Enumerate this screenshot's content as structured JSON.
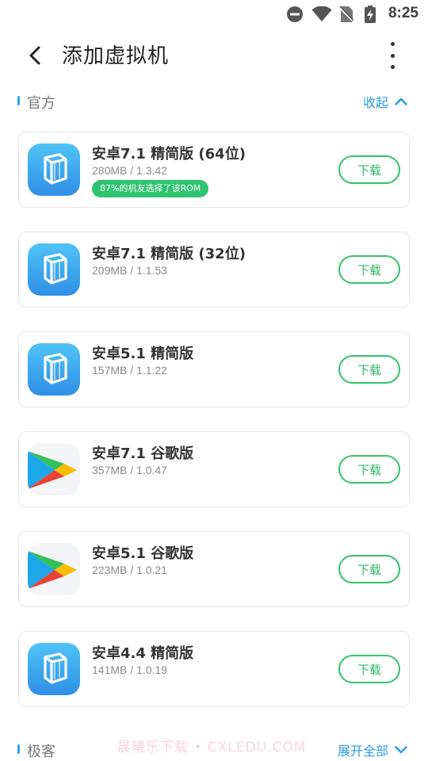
{
  "status_bar": {
    "time": "8:25",
    "icons": [
      "dnd-icon",
      "wifi-icon",
      "no-sim-icon",
      "battery-charging-icon"
    ]
  },
  "header": {
    "title": "添加虚拟机",
    "back_icon": "back-arrow-icon",
    "more_icon": "more-vertical-icon"
  },
  "sections": [
    {
      "title": "官方",
      "toggle_label": "收起",
      "toggle_icon": "chevron-up-icon"
    },
    {
      "title": "极客",
      "toggle_label": "展开全部",
      "toggle_icon": "chevron-down-icon"
    }
  ],
  "roms": [
    {
      "name": "安卓7.1 精简版 (64位)",
      "meta": "280MB / 1.3.42",
      "badge": "87%的机友选择了该ROM",
      "icon": "vm-cube-icon",
      "button": "下载"
    },
    {
      "name": "安卓7.1 精简版 (32位)",
      "meta": "209MB / 1.1.53",
      "icon": "vm-cube-icon",
      "button": "下载"
    },
    {
      "name": "安卓5.1 精简版",
      "meta": "157MB / 1.1.22",
      "icon": "vm-cube-icon",
      "button": "下载"
    },
    {
      "name": "安卓7.1 谷歌版",
      "meta": "357MB / 1.0.47",
      "icon": "google-play-icon",
      "button": "下载"
    },
    {
      "name": "安卓5.1 谷歌版",
      "meta": "223MB / 1.0.21",
      "icon": "google-play-icon",
      "button": "下载"
    },
    {
      "name": "安卓4.4 精简版",
      "meta": "141MB / 1.0.19",
      "icon": "vm-cube-icon",
      "button": "下载"
    }
  ],
  "watermark": "晨曦乐下载 • CXLEDU.COM",
  "colors": {
    "accent_blue": "#2b9de0",
    "download_green": "#34c26e",
    "badge_green": "#2fc46f"
  }
}
